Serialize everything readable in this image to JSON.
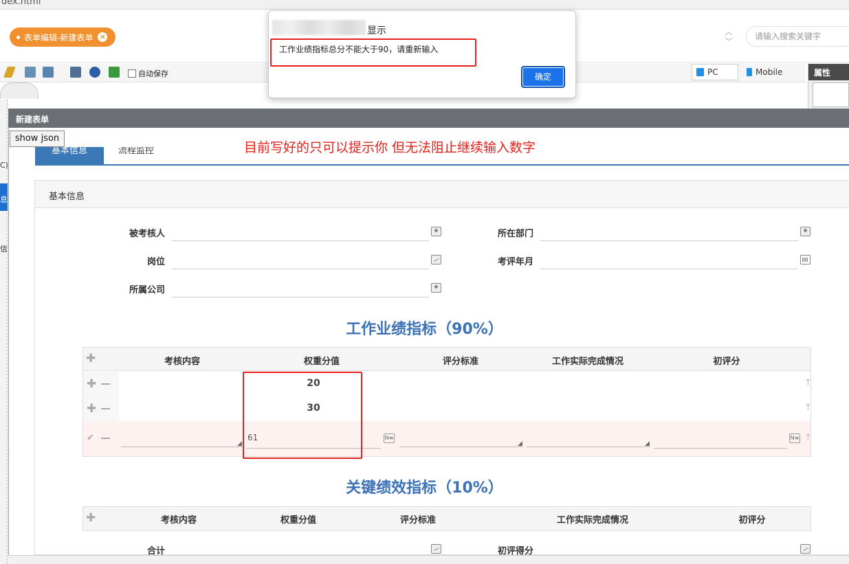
{
  "browser": {
    "url_fragment": "dex.html"
  },
  "header": {
    "tab_label": "表单编辑-新建表单",
    "search_placeholder": "请输入搜索关键字"
  },
  "toolbar": {
    "autosave_label": "自动保存",
    "device_pc": "PC",
    "device_mobile": "Mobile",
    "props_title": "属性"
  },
  "left_strip": {
    "text1": "C)",
    "text2": "息",
    "text3": "信"
  },
  "window": {
    "title": "新建表单",
    "show_json_label": "show json",
    "annotation": "目前写好的只可以提示你 但无法阻止继续输入数字"
  },
  "nav": {
    "tab_active": "基本信息",
    "tab_2": "流程监控"
  },
  "form": {
    "section_title": "基本信息",
    "fields": {
      "examinee": "被考核人",
      "department": "所在部门",
      "position": "岗位",
      "eval_month": "考评年月",
      "company": "所属公司"
    }
  },
  "perf_table": {
    "title": "工作业绩指标（90%）",
    "headers": [
      "考核内容",
      "权重分值",
      "评分标准",
      "工作实际完成情况",
      "初评分"
    ],
    "rows": [
      {
        "weight": "20"
      },
      {
        "weight": "30"
      },
      {
        "weight_input": "61"
      }
    ],
    "ne_icon": "N≡"
  },
  "kpi_table": {
    "title": "关键绩效指标（10%）",
    "headers": [
      "考核内容",
      "权重分值",
      "评分标准",
      "工作实际完成情况",
      "初评分"
    ]
  },
  "footer_fields": {
    "total": "合计",
    "initial_score": "初评得分"
  },
  "alert": {
    "title": "显示",
    "message": "工作业绩指标总分不能大于90，请重新输入",
    "ok_label": "确定"
  },
  "colors": {
    "accent_orange": "#f0902e",
    "primary_blue": "#3d72b5",
    "annotation_red": "#e8201b",
    "button_blue": "#1a73e8"
  }
}
